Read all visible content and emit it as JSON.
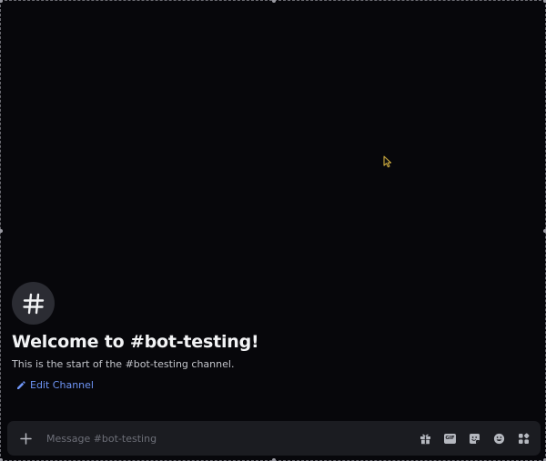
{
  "channel": {
    "welcome_title": "Welcome to #bot-testing!",
    "welcome_subtitle": "This is the start of the #bot-testing channel.",
    "edit_label": "Edit Channel",
    "hash_glyph": "#"
  },
  "composer": {
    "placeholder": "Message #bot-testing",
    "gif_label": "GIF",
    "icons": [
      "plus-icon",
      "gift-icon",
      "gif-icon",
      "sticker-icon",
      "emoji-icon",
      "apps-icon"
    ]
  },
  "colors": {
    "background": "#07070b",
    "composer": "#1b1c21",
    "link": "#6e94f5",
    "icon": "#b5b8bf"
  }
}
